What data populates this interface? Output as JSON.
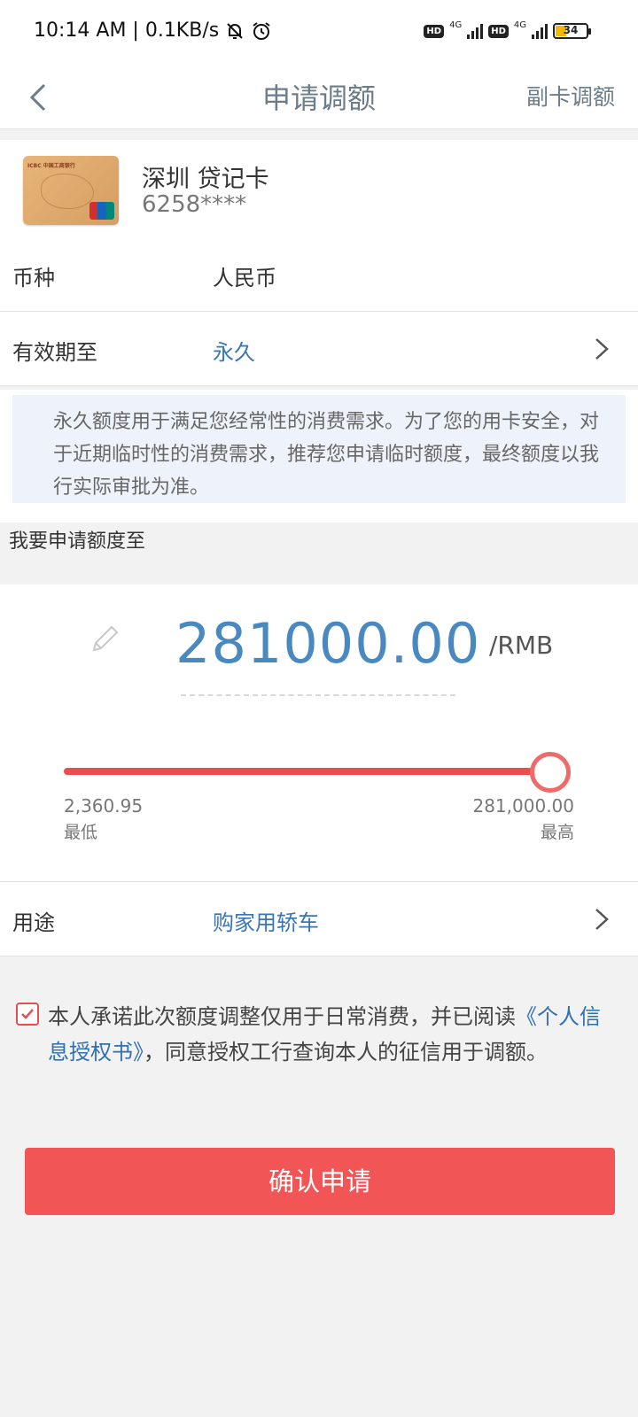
{
  "status": {
    "time": "10:14 AM | 0.1KB/s",
    "hd": "HD",
    "network": "4G",
    "battery": "34"
  },
  "nav": {
    "title": "申请调额",
    "right": "副卡调额"
  },
  "card": {
    "bank_logo_text": "ICBC 中国工商银行",
    "name": "深圳 贷记卡",
    "number": "6258****"
  },
  "currency": {
    "label": "币种",
    "value": "人民币"
  },
  "validity": {
    "label": "有效期至",
    "value": "永久"
  },
  "notice": "永久额度用于满足您经常性的消费需求。为了您的用卡安全，对于近期临时性的消费需求，推荐您申请临时额度，最终额度以我行实际审批为准。",
  "section_title": "我要申请额度至",
  "amount": {
    "value": "281000.00",
    "unit": "/RMB",
    "slider_fraction": 1.0,
    "min_value": "2,360.95",
    "min_label": "最低",
    "max_value": "281,000.00",
    "max_label": "最高"
  },
  "purpose": {
    "label": "用途",
    "value": "购家用轿车"
  },
  "agreement": {
    "checked": true,
    "text_before": "本人承诺此次额度调整仅用于日常消费，并已阅读",
    "link": "《个人信息授权书》",
    "text_after": "，同意授权工行查询本人的征信用于调额。"
  },
  "confirm_label": "确认申请",
  "colors": {
    "accent": "#f25555",
    "link": "#3a76b5",
    "amount": "#4a89bf"
  }
}
